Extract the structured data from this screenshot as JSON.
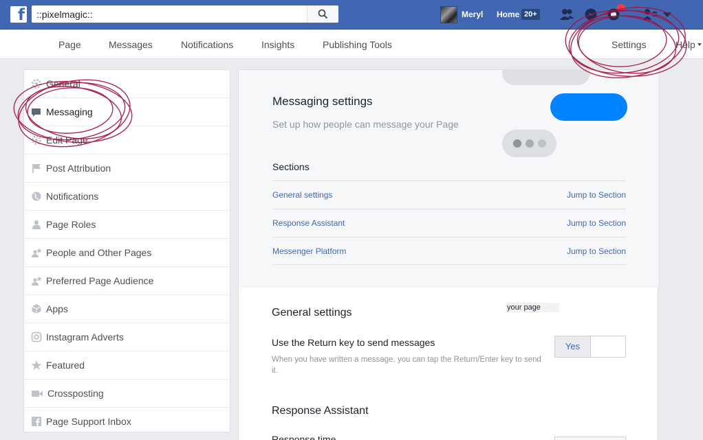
{
  "topbar": {
    "search_value": "::pixelmagic::",
    "user_name": "Meryl",
    "home_label": "Home",
    "home_badge": "20+",
    "icons": [
      "friend-requests-icon",
      "messages-icon",
      "notifications-icon",
      "quick-help-icon",
      "account-menu-icon"
    ],
    "brand_color": "#4267b2"
  },
  "page_nav": {
    "items": [
      "Page",
      "Messages",
      "Notifications",
      "Insights",
      "Publishing Tools"
    ],
    "settings": "Settings",
    "help": "Help"
  },
  "sidebar": {
    "items": [
      {
        "label": "General",
        "icon": "gear-icon"
      },
      {
        "label": "Messaging",
        "icon": "message-bubble-icon"
      },
      {
        "label": "Edit Page",
        "icon": "gear-icon"
      },
      {
        "label": "Post Attribution",
        "icon": "flag-icon"
      },
      {
        "label": "Notifications",
        "icon": "globe-icon"
      },
      {
        "label": "Page Roles",
        "icon": "person-icon"
      },
      {
        "label": "People and Other Pages",
        "icon": "person-star-icon"
      },
      {
        "label": "Preferred Page Audience",
        "icon": "person-star-icon"
      },
      {
        "label": "Apps",
        "icon": "cube-icon"
      },
      {
        "label": "Instagram Adverts",
        "icon": "instagram-icon"
      },
      {
        "label": "Featured",
        "icon": "star-icon"
      },
      {
        "label": "Crossposting",
        "icon": "video-camera-icon"
      },
      {
        "label": "Page Support Inbox",
        "icon": "facebook-icon"
      }
    ],
    "active": "Messaging"
  },
  "main": {
    "title": "Messaging settings",
    "subtitle": "Set up how people can message your Page",
    "sections_heading": "Sections",
    "sections": [
      {
        "name": "General settings",
        "action": "Jump to Section"
      },
      {
        "name": "Response Assistant",
        "action": "Jump to Section"
      },
      {
        "name": "Messenger Platform",
        "action": "Jump to Section"
      }
    ],
    "general": {
      "title": "General settings",
      "tooltip": "your page",
      "return_key_label": "Use the Return key to send messages",
      "return_key_help": "When you have written a message, you can tap the Return/Enter key to send it.",
      "toggle_yes": "Yes",
      "toggle_no": ""
    },
    "response_assistant": {
      "title": "Response Assistant",
      "response_time_label": "Response time"
    },
    "messenger_blue": "#0084ff"
  },
  "annotation_color": "#a3123f"
}
